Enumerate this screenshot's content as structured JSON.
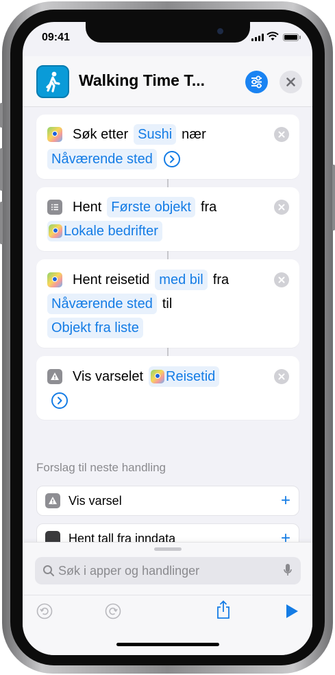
{
  "status_bar": {
    "time": "09:41"
  },
  "header": {
    "title": "Walking Time T..."
  },
  "actions": [
    {
      "line1": {
        "prefix": "Søk etter",
        "token": "Sushi",
        "suffix": "nær"
      },
      "line2": {
        "token": "Nåværende sted"
      }
    },
    {
      "line1": {
        "prefix": "Hent",
        "token": "Første objekt",
        "suffix": "fra"
      },
      "line2": {
        "token": "Lokale bedrifter"
      }
    },
    {
      "line1": {
        "prefix": "Hent reisetid",
        "token": "med bil",
        "suffix": "fra"
      },
      "line2": {
        "token": "Nåværende sted",
        "suffix": "til"
      },
      "line3": {
        "token": "Objekt fra liste"
      }
    },
    {
      "line1": {
        "prefix": "Vis varselet",
        "token": "Reisetid"
      }
    }
  ],
  "suggestions": {
    "title": "Forslag til neste handling",
    "items": [
      {
        "label": "Vis varsel"
      },
      {
        "label": "Hent tall fra inndata"
      }
    ]
  },
  "search": {
    "placeholder": "Søk i apper og handlinger"
  },
  "colors": {
    "accent": "#147ce5",
    "token_bg": "#e8f1fc",
    "app_icon": "#0a9bd8",
    "background": "#f2f2f7"
  },
  "icons": {
    "app": "walking-person-icon",
    "settings": "sliders-icon",
    "close": "close-icon",
    "maps": "maps-icon",
    "list": "list-icon",
    "alert": "alert-icon",
    "undo": "undo-icon",
    "redo": "redo-icon",
    "share": "share-icon",
    "play": "play-icon",
    "mic": "microphone-icon"
  }
}
